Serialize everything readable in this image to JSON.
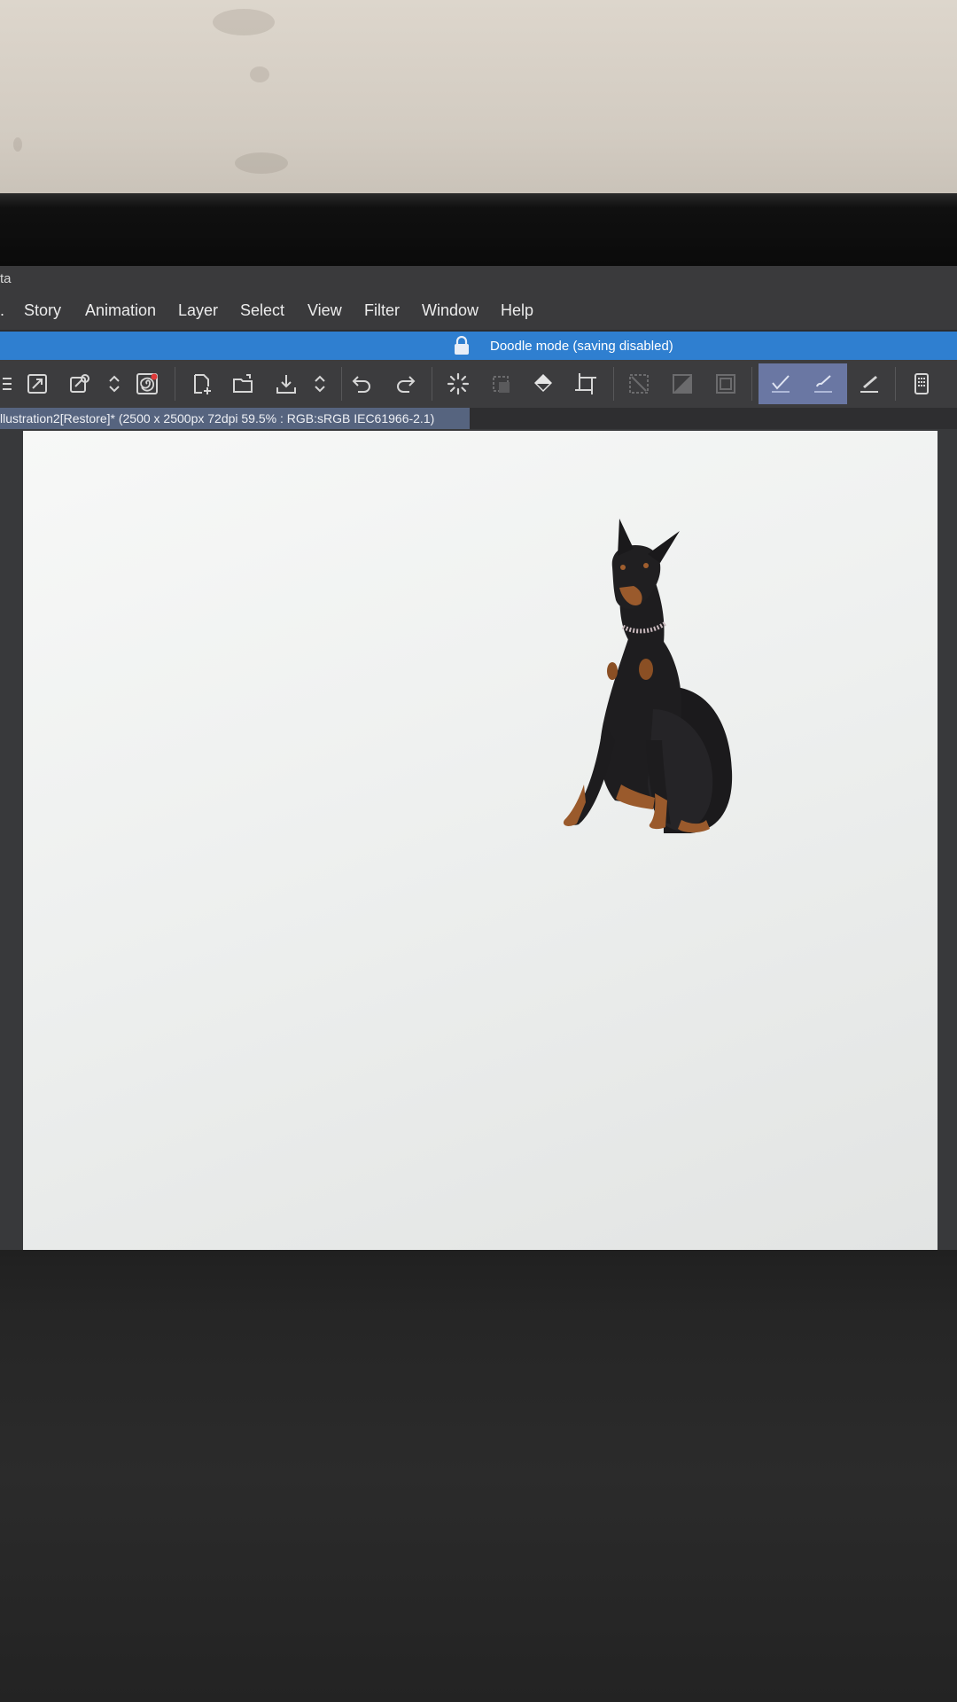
{
  "window": {
    "title_fragment": "ta"
  },
  "menubar": {
    "items": [
      "Story",
      "Animation",
      "Layer",
      "Select",
      "View",
      "Filter",
      "Window",
      "Help"
    ]
  },
  "banner": {
    "text": "Doodle mode (saving disabled)",
    "color": "#2f7fd0"
  },
  "toolbar": {
    "icons": [
      "menu-icon",
      "expand-icon",
      "settings-icon",
      "up-down-icon",
      "spiral-icon",
      "new-icon",
      "open-icon",
      "save-icon",
      "up-down-icon",
      "undo-icon",
      "redo-icon",
      "spinner-icon",
      "square-icon",
      "fill-icon",
      "transform-icon",
      "clear-icon",
      "diagonal-icon",
      "border-icon",
      "pen-check-icon",
      "brush-icon",
      "ruler-pen-icon",
      "device-icon"
    ],
    "active_icons": [
      "pen-check-icon",
      "brush-icon"
    ],
    "active_color": "#6a77a3"
  },
  "document": {
    "tab_label": "llustration2[Restore]* (2500 x 2500px 72dpi 59.5% : RGB:sRGB IEC61966-2.1)"
  },
  "canvas": {
    "content": "doberman-image"
  }
}
